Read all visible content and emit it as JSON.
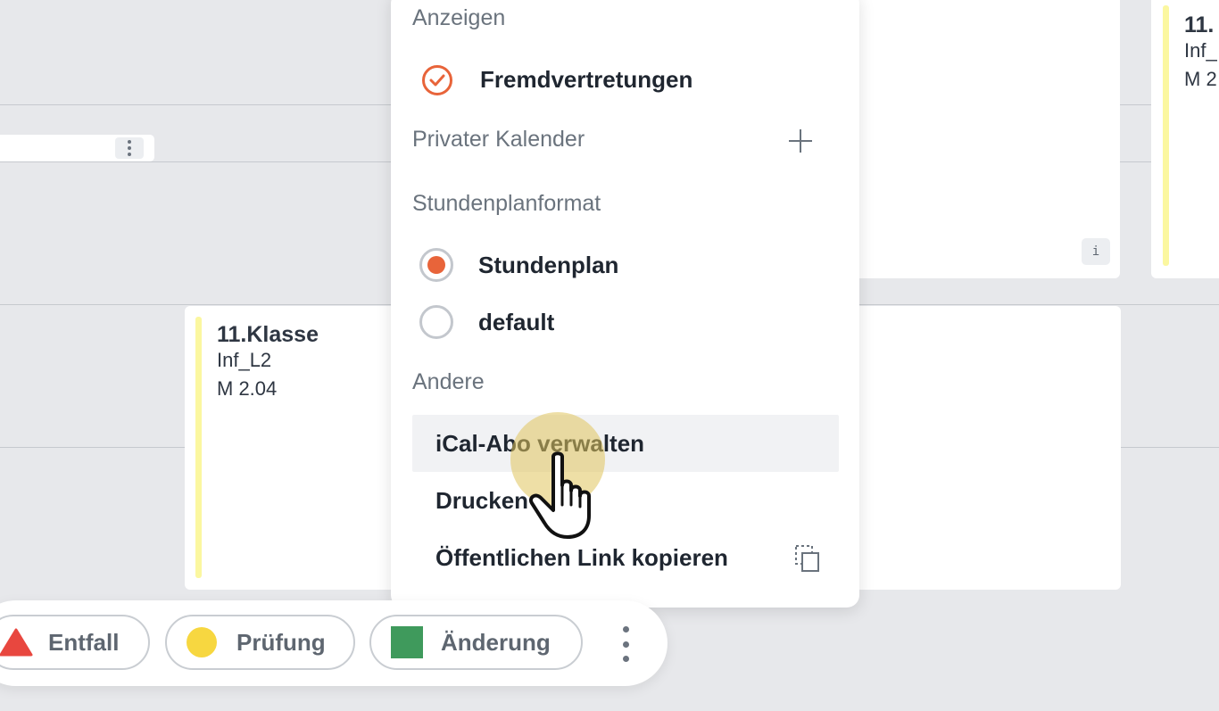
{
  "background_cards": {
    "left_lesson": {
      "title": "11.Klasse",
      "subject": "Inf_L2",
      "room": "M 2.04",
      "accent_color": "#fbf7a0"
    },
    "right_lesson": {
      "title": "11.",
      "subject": "Inf_",
      "room": "M 2"
    },
    "info_chip_text": "i"
  },
  "menu": {
    "section_show": "Anzeigen",
    "external_substitutions": {
      "label": "Fremdvertretungen",
      "checked": true
    },
    "private_calendar": {
      "label": "Privater Kalender",
      "action_icon": "plus-icon"
    },
    "section_format": "Stundenplanformat",
    "format_options": [
      {
        "label": "Stundenplan",
        "selected": true
      },
      {
        "label": "default",
        "selected": false
      }
    ],
    "section_other": "Andere",
    "other_items": [
      {
        "label": "iCal-Abo verwalten",
        "highlighted": true
      },
      {
        "label": "Drucken"
      },
      {
        "label": "Öffentlichen Link kopieren",
        "icon": "copy-icon"
      }
    ],
    "accent_color": "#e8643a"
  },
  "legend": {
    "items": [
      {
        "label": "Entfall",
        "icon": "red-triangle-icon",
        "color": "#e8473f"
      },
      {
        "label": "Prüfung",
        "icon": "yellow-circle-icon",
        "color": "#f7d740"
      },
      {
        "label": "Änderung",
        "icon": "green-square-icon",
        "color": "#3f9a5c"
      }
    ],
    "more_icon": "vertical-dots-icon"
  }
}
